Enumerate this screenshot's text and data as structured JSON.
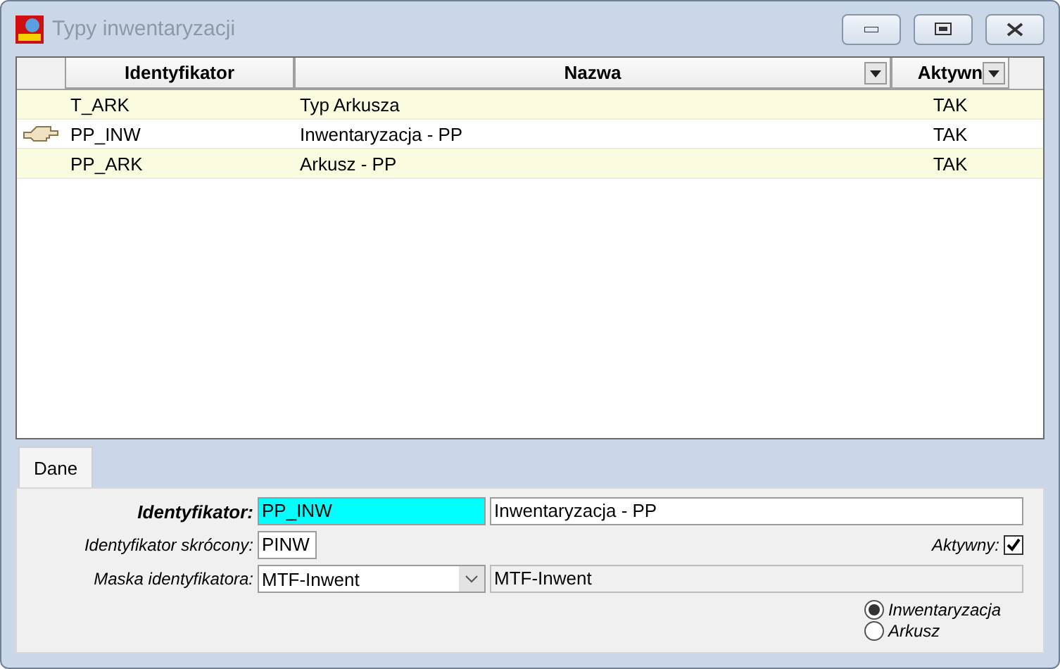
{
  "window": {
    "title": "Typy inwentaryzacji"
  },
  "table": {
    "columns": [
      {
        "label": "Identyfikator",
        "dropdown": false
      },
      {
        "label": "Nazwa",
        "dropdown": true
      },
      {
        "label": "Aktywn",
        "dropdown": true
      }
    ],
    "rows": [
      {
        "cells": [
          "T_ARK",
          "Typ Arkusza",
          "TAK"
        ],
        "current": false
      },
      {
        "cells": [
          "PP_INW",
          "Inwentaryzacja - PP",
          "TAK"
        ],
        "current": true
      },
      {
        "cells": [
          "PP_ARK",
          "Arkusz - PP",
          "TAK"
        ],
        "current": false
      }
    ]
  },
  "tabs": [
    {
      "label": "Dane",
      "selected": true
    }
  ],
  "form": {
    "identifier": {
      "label": "Identyfikator:",
      "value": "PP_INW",
      "name_value": "Inwentaryzacja - PP"
    },
    "short_identifier": {
      "label": "Identyfikator skrócony:",
      "value": "PINW"
    },
    "active": {
      "label": "Aktywny:",
      "checked": true
    },
    "mask": {
      "label": "Maska identyfikatora:",
      "value": "MTF-Inwent",
      "display": "MTF-Inwent"
    },
    "type_options": [
      {
        "label": "Inwentaryzacja",
        "selected": true
      },
      {
        "label": "Arkusz",
        "selected": false
      }
    ]
  }
}
